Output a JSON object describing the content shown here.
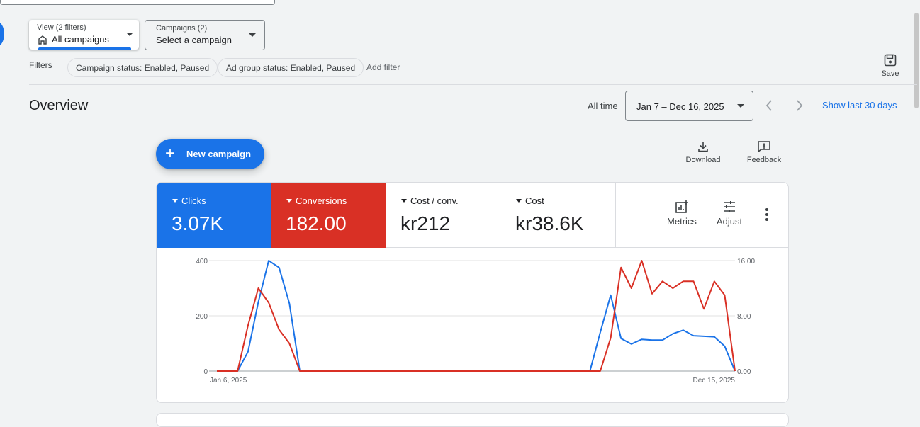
{
  "view": {
    "label": "View (2 filters)",
    "value": "All campaigns"
  },
  "campaigns": {
    "label": "Campaigns (2)",
    "value": "Select a campaign"
  },
  "filters": {
    "label": "Filters",
    "chips": [
      "Campaign status: Enabled, Paused",
      "Ad group status: Enabled, Paused"
    ],
    "add_filter": "Add filter"
  },
  "save_label": "Save",
  "overview": {
    "title": "Overview",
    "all_time": "All time",
    "date_range": "Jan 7 – Dec 16, 2025",
    "show_last": "Show last 30 days"
  },
  "new_campaign": "New campaign",
  "tools": {
    "download": "Download",
    "feedback": "Feedback"
  },
  "metrics": [
    {
      "label": "Clicks",
      "value": "3.07K",
      "color": "#1a73e8"
    },
    {
      "label": "Conversions",
      "value": "182.00",
      "color": "#d93025"
    },
    {
      "label": "Cost / conv.",
      "value": "kr212"
    },
    {
      "label": "Cost",
      "value": "kr38.6K"
    }
  ],
  "metric_tools": {
    "metrics": "Metrics",
    "adjust": "Adjust"
  },
  "chart_data": {
    "type": "line",
    "x_start_label": "Jan 6, 2025",
    "x_end_label": "Dec 15, 2025",
    "y_left_ticks": [
      "0",
      "200",
      "400"
    ],
    "y_right_ticks": [
      "0.00",
      "8.00",
      "16.00"
    ],
    "y_left_lim": [
      0,
      400
    ],
    "y_right_lim": [
      0,
      16
    ],
    "series": [
      {
        "axis": "left",
        "color": "#1a73e8",
        "values": [
          0,
          0,
          0,
          70,
          250,
          400,
          375,
          245,
          0,
          0,
          0,
          0,
          0,
          0,
          0,
          0,
          0,
          0,
          0,
          0,
          0,
          0,
          0,
          0,
          0,
          0,
          0,
          0,
          0,
          0,
          0,
          0,
          0,
          0,
          0,
          0,
          0,
          140,
          275,
          118,
          98,
          115,
          112,
          112,
          135,
          148,
          128,
          126,
          124,
          90,
          0
        ]
      },
      {
        "axis": "right",
        "color": "#d93025",
        "values": [
          0,
          0,
          0,
          6.6,
          12.0,
          9.9,
          6.0,
          4.0,
          0,
          0,
          0,
          0,
          0,
          0,
          0,
          0,
          0,
          0,
          0,
          0,
          0,
          0,
          0,
          0,
          0,
          0,
          0,
          0,
          0,
          0,
          0,
          0,
          0,
          0,
          0,
          0,
          0,
          0,
          4.8,
          15.0,
          12.0,
          16.0,
          11.2,
          13.0,
          12.0,
          13.0,
          13.0,
          9.0,
          13.0,
          11.0,
          0
        ]
      }
    ]
  }
}
